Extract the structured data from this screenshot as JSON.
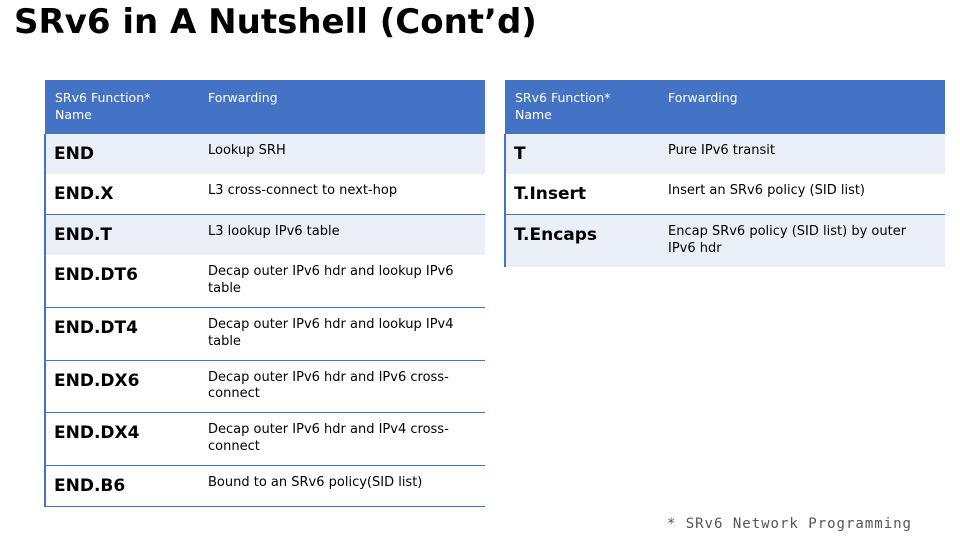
{
  "slide": {
    "title": "SRv6 in A Nutshell (Cont’d)",
    "footnote": "* SRv6 Network Programming",
    "accent_color": "#4472c4",
    "shade_color": "#e9eef7"
  },
  "tables": [
    {
      "id": "left-table",
      "headers": [
        "SRv6 Function*\nName",
        "Forwarding"
      ],
      "header_col1_line1": "SRv6 Function*",
      "header_col1_line2": "Name",
      "header_col2": "Forwarding",
      "rows": [
        {
          "name": "END",
          "forwarding": "Lookup SRH",
          "shaded": true
        },
        {
          "name": "END.X",
          "forwarding": "L3 cross-connect to next-hop",
          "shaded": false
        },
        {
          "name": "END.T",
          "forwarding": "L3 lookup IPv6 table",
          "shaded": true
        },
        {
          "name": "END.DT6",
          "forwarding": "Decap outer IPv6 hdr and lookup IPv6 table",
          "shaded": false
        },
        {
          "name": "END.DT4",
          "forwarding": "Decap outer IPv6 hdr and lookup IPv4 table",
          "shaded": false
        },
        {
          "name": "END.DX6",
          "forwarding": "Decap outer IPv6 hdr and IPv6 cross-connect",
          "shaded": false
        },
        {
          "name": "END.DX4",
          "forwarding": "Decap outer IPv6 hdr and IPv4 cross-connect",
          "shaded": false
        },
        {
          "name": "END.B6",
          "forwarding": "Bound to an SRv6 policy(SID list)",
          "shaded": false
        }
      ]
    },
    {
      "id": "right-table",
      "header_col1_line1": "SRv6 Function*",
      "header_col1_line2": "Name",
      "header_col2": "Forwarding",
      "rows": [
        {
          "name": "T",
          "forwarding": "Pure IPv6 transit",
          "shaded": true
        },
        {
          "name": "T.Insert",
          "forwarding": "Insert an SRv6 policy (SID list)",
          "shaded": false
        },
        {
          "name": "T.Encaps",
          "forwarding": "Encap SRv6 policy (SID list) by outer IPv6 hdr",
          "shaded": true
        }
      ]
    }
  ]
}
